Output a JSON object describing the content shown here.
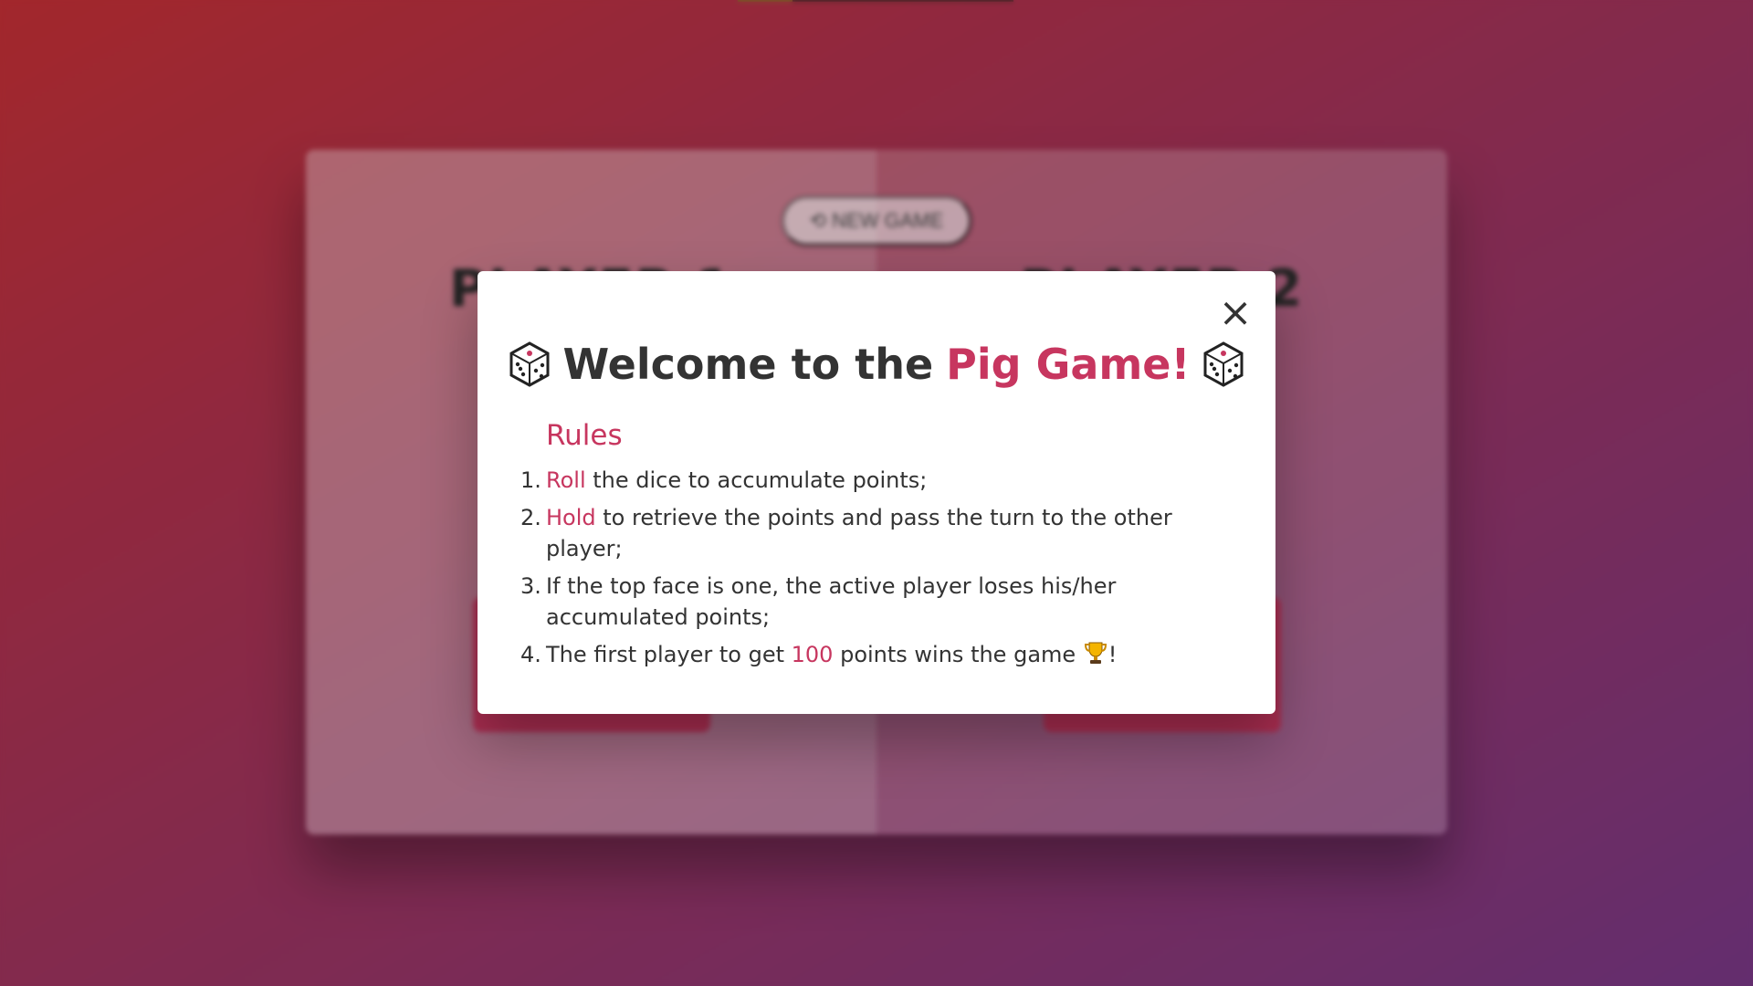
{
  "board": {
    "new_game_label": "⟲ New Game",
    "player_1_name": "Player 1",
    "player_2_name": "Player 2",
    "player_1_score": "",
    "player_2_score": "",
    "current_label": "",
    "roll_label": "",
    "hold_label": ""
  },
  "modal": {
    "close_label": "×",
    "title_prefix": "Welcome to the ",
    "title_accent": "Pig Game!",
    "dice_icon": "dice-icon",
    "rules_heading": "Rules",
    "rules": [
      {
        "num": "1.",
        "accent": "Roll",
        "text": " the dice to accumulate points;"
      },
      {
        "num": "2.",
        "accent": "Hold",
        "text": " to retrieve the points and pass the turn to the other player;"
      },
      {
        "num": "3.",
        "text": "If the top face is one, the active player loses his/her accumulated points;"
      },
      {
        "num": "4.",
        "text_before": "The first player to get ",
        "accent": "100",
        "text_after": " points wins the game ",
        "trophy_icon": "trophy-icon",
        "end": "!"
      }
    ]
  },
  "colors": {
    "accent": "#c7365f",
    "text": "#333333",
    "gradient_start": "#bf2e34",
    "gradient_end": "#753682"
  }
}
